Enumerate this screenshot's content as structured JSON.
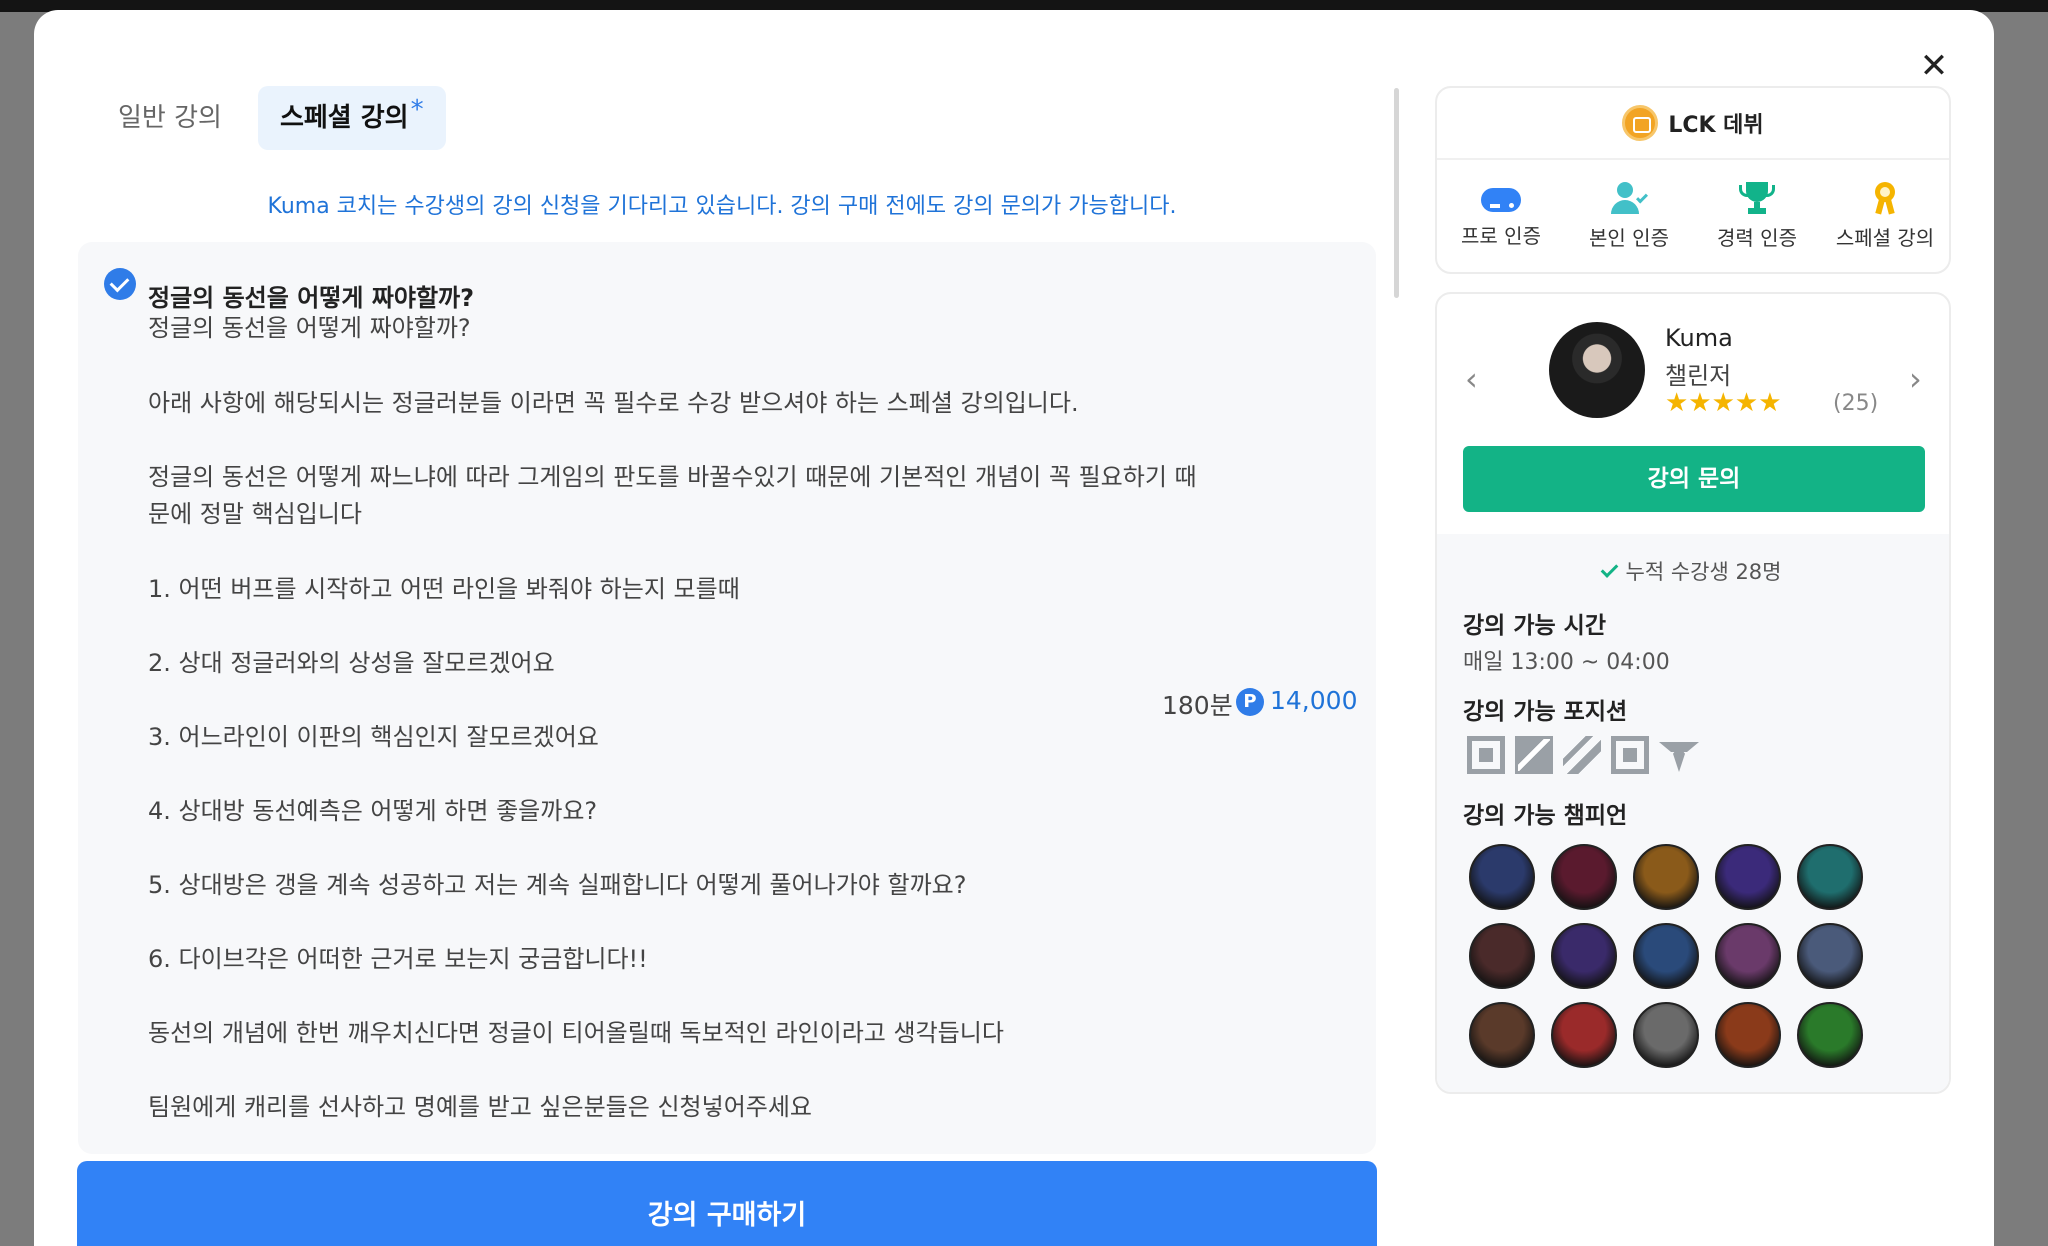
{
  "tabs": [
    {
      "label": "일반 강의",
      "active": false
    },
    {
      "label": "스페셜 강의",
      "active": true,
      "marker": "*"
    }
  ],
  "notice": "Kuma 코치는 수강생의 강의 신청을 기다리고 있습니다. 강의 구매 전에도 강의 문의가 가능합니다.",
  "lecture": {
    "title": "정글의 동선을 어떻게 짜야할까?",
    "description": [
      "정글의 동선을 어떻게 짜야할까?",
      "아래 사항에 해당되시는 정글러분들 이라면 꼭 필수로 수강 받으셔야 하는 스페셜 강의입니다.",
      "정글의 동선은 어떻게 짜느냐에 따라 그게임의 판도를 바꿀수있기 때문에 기본적인 개념이 꼭 필요하기 때문에 정말 핵심입니다",
      "1. 어떤 버프를 시작하고 어떤 라인을 봐줘야 하는지 모를때",
      "2. 상대 정글러와의 상성을 잘모르겠어요",
      "3. 어느라인이 이판의 핵심인지 잘모르겠어요",
      "4. 상대방 동선예측은 어떻게 하면 좋을까요?",
      "5. 상대방은 갱을 계속 성공하고 저는 계속 실패합니다 어떻게 풀어나가야 할까요?",
      "6. 다이브각은 어떠한 근거로 보는지 궁금합니다!!",
      "동선의 개념에 한번 깨우치신다면 정글이 티어올릴때 독보적인 라인이라고 생각듭니다",
      "팀원에게 캐리를 선사하고 명예를 받고 싶은분들은 신청넣어주세요"
    ],
    "duration": "180분",
    "price_icon": "P",
    "price": "14,000"
  },
  "buy_button": "강의 구매하기",
  "close_icon": "✕",
  "badge": {
    "label": "LCK 데뷔",
    "icon": "lck-badge-icon"
  },
  "certifications": [
    {
      "label": "프로 인증",
      "icon": "gamepad-icon"
    },
    {
      "label": "본인 인증",
      "icon": "user-check-icon"
    },
    {
      "label": "경력 인증",
      "icon": "trophy-icon"
    },
    {
      "label": "스페셜 강의",
      "icon": "medal-icon"
    }
  ],
  "coach": {
    "name": "Kuma",
    "tier": "챌린저",
    "rating_stars": 5,
    "stars_text": "★★★★★",
    "rating_count": "(25)",
    "prev_arrow": "‹",
    "next_arrow": "›"
  },
  "inquiry_button": "강의 문의",
  "students": "누적 수강생 28명",
  "schedule": {
    "title": "강의 가능 시간",
    "value": "매일 13:00 ~ 04:00"
  },
  "positions": {
    "title": "강의 가능 포지션",
    "items": [
      "top",
      "jungle",
      "mid",
      "bot",
      "support"
    ]
  },
  "champions": {
    "title": "강의 가능 챔피언",
    "colors": [
      "#2b3a6b",
      "#5a1a2e",
      "#8a5a1a",
      "#3b2a7a",
      "#1f6e6e",
      "#4a2a2a",
      "#3a2a6a",
      "#2a4a7a",
      "#6a3a6a",
      "#4a5a7a",
      "#5a3a2a",
      "#9a2a2a",
      "#6a6a6a",
      "#8a3a1a",
      "#2a7a2a"
    ]
  },
  "colors": {
    "primary": "#3182f6",
    "accent_green": "#13b386",
    "star": "#f5b400"
  }
}
